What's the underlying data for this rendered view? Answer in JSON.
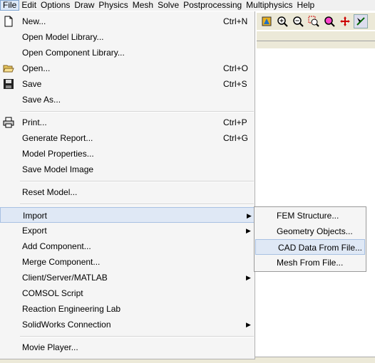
{
  "menubar": {
    "items": [
      "File",
      "Edit",
      "Options",
      "Draw",
      "Physics",
      "Mesh",
      "Solve",
      "Postprocessing",
      "Multiphysics",
      "Help"
    ]
  },
  "file_menu": {
    "items": [
      {
        "label": "New...",
        "shortcut": "Ctrl+N",
        "icon": "new-document-icon"
      },
      {
        "label": "Open Model Library..."
      },
      {
        "label": "Open Component Library..."
      },
      {
        "label": "Open...",
        "shortcut": "Ctrl+O",
        "icon": "folder-open-icon"
      },
      {
        "label": "Save",
        "shortcut": "Ctrl+S",
        "icon": "floppy-disk-icon"
      },
      {
        "label": "Save As..."
      },
      {
        "label": "Print...",
        "shortcut": "Ctrl+P",
        "icon": "printer-icon"
      },
      {
        "label": "Generate Report...",
        "shortcut": "Ctrl+G"
      },
      {
        "label": "Model Properties..."
      },
      {
        "label": "Save Model Image"
      },
      {
        "label": "Reset Model..."
      },
      {
        "label": "Import",
        "submenu": true
      },
      {
        "label": "Export",
        "submenu": true
      },
      {
        "label": "Add Component..."
      },
      {
        "label": "Merge Component..."
      },
      {
        "label": "Client/Server/MATLAB",
        "submenu": true
      },
      {
        "label": "COMSOL Script"
      },
      {
        "label": "Reaction Engineering Lab"
      },
      {
        "label": "SolidWorks Connection",
        "submenu": true
      },
      {
        "label": "Movie Player..."
      }
    ]
  },
  "import_submenu": {
    "items": [
      "FEM Structure...",
      "Geometry Objects...",
      "CAD Data From File...",
      "Mesh From File..."
    ]
  },
  "toolbar": {
    "icons": [
      "visualization-icon",
      "zoom-in-icon",
      "zoom-out-icon",
      "zoom-window-icon",
      "zoom-selected-icon",
      "pan-icon",
      "select-mode-icon"
    ]
  },
  "colors": {
    "menu_bg": "#f5f5f5",
    "highlight_bg": "#dfe8f5",
    "highlight_border": "#a8c1e3",
    "toolbar_bg": "#ece9d8"
  }
}
